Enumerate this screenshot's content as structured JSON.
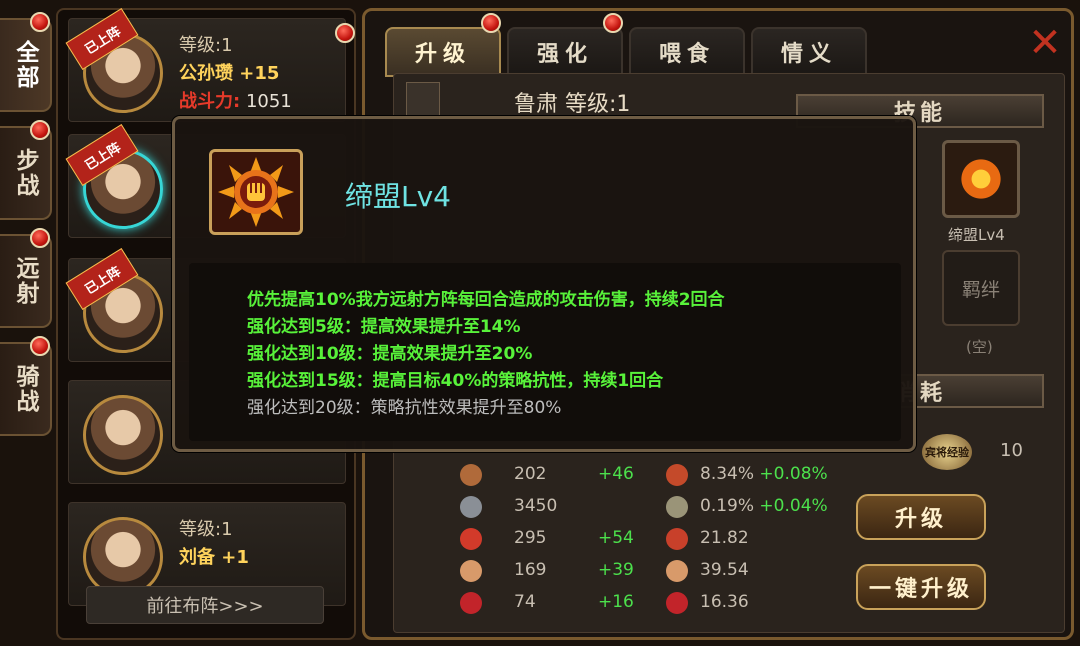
{
  "categories": [
    {
      "label": "全部",
      "active": true
    },
    {
      "label": "步战",
      "active": false
    },
    {
      "label": "远射",
      "active": false
    },
    {
      "label": "骑战",
      "active": false
    }
  ],
  "hero_list": {
    "deploy_tag": "已上阵",
    "heroes": [
      {
        "level": "等级:1",
        "name": "公孙瓒 +15",
        "power_label": "战斗力:",
        "power": "1051",
        "deployed": true
      },
      {
        "level": "",
        "name": "",
        "power_label": "",
        "power": "",
        "deployed": true,
        "selected": true
      },
      {
        "level": "",
        "name": "",
        "power_label": "",
        "power": "",
        "deployed": true
      },
      {
        "level": "",
        "name": "",
        "power_label": "",
        "power": "",
        "deployed": false
      },
      {
        "level": "等级:1",
        "name": "刘备 +1",
        "power_label": "",
        "power": "",
        "deployed": false
      }
    ],
    "goto_button": "前往布阵>>>"
  },
  "tabs": [
    {
      "label": "升级",
      "active": true
    },
    {
      "label": "强化",
      "active": false
    },
    {
      "label": "喂食",
      "active": false
    },
    {
      "label": "情义",
      "active": false
    }
  ],
  "hero_header": "鲁肃 等级:1",
  "skill_section": "技能",
  "consume_section": "消耗",
  "skill_name": "缔盟Lv4",
  "bond_label": "羁绊",
  "bond_value": "(空)",
  "exp_item_label": "宾将经验",
  "exp_count": "10",
  "stats": [
    {
      "v1": "202",
      "v2": "+46",
      "v3": "8.34%",
      "v3b": "+0.08%"
    },
    {
      "v1": "3450",
      "v2": "",
      "v3": "0.19%",
      "v3b": "+0.04%"
    },
    {
      "v1": "295",
      "v2": "+54",
      "v3": "21.82",
      "v3b": ""
    },
    {
      "v1": "169",
      "v2": "+39",
      "v3": "39.54",
      "v3b": ""
    },
    {
      "v1": "74",
      "v2": "+16",
      "v3": "16.36",
      "v3b": ""
    }
  ],
  "buttons": {
    "upgrade": "升级",
    "one_key_upgrade": "一键升级"
  },
  "popup": {
    "title": "缔盟Lv4",
    "lines": [
      {
        "text": "优先提高10%我方远射方阵每回合造成的攻击伤害，持续2回合",
        "unlocked": true
      },
      {
        "text": "强化达到5级：提高效果提升至14%",
        "unlocked": true
      },
      {
        "text": "强化达到10级：提高效果提升至20%",
        "unlocked": true
      },
      {
        "text": "强化达到15级：提高目标40%的策略抗性，持续1回合",
        "unlocked": true
      },
      {
        "text": "强化达到20级：策略抗性效果提升至80%",
        "unlocked": false
      }
    ]
  },
  "colors": {
    "accent_green": "#58f23a",
    "title_cyan": "#6fe3e3",
    "frame_gold": "#7a5a2e",
    "alert_red": "#c4150f"
  }
}
